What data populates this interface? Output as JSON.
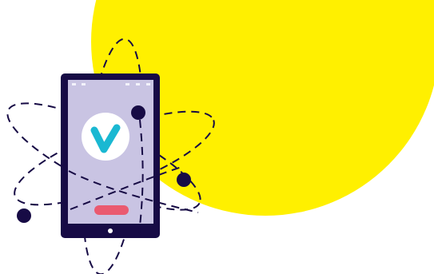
{
  "illustration": {
    "subject": "phone-with-orbits",
    "colors": {
      "background": "#ffffff",
      "circle": "#fff000",
      "device_frame": "#170b45",
      "screen": "#c9c4e3",
      "logo_bg": "#ffffff",
      "logo_check": "#1ab8d2",
      "cta_button": "#ea5a70",
      "orbit_line": "#170b45",
      "status_dots": "#f3f2fb",
      "home_button": "#ffffff",
      "orbit_nodes": "#170b45"
    },
    "icons": {
      "logo": "checkmark-v-icon",
      "home": "home-button-icon"
    }
  }
}
